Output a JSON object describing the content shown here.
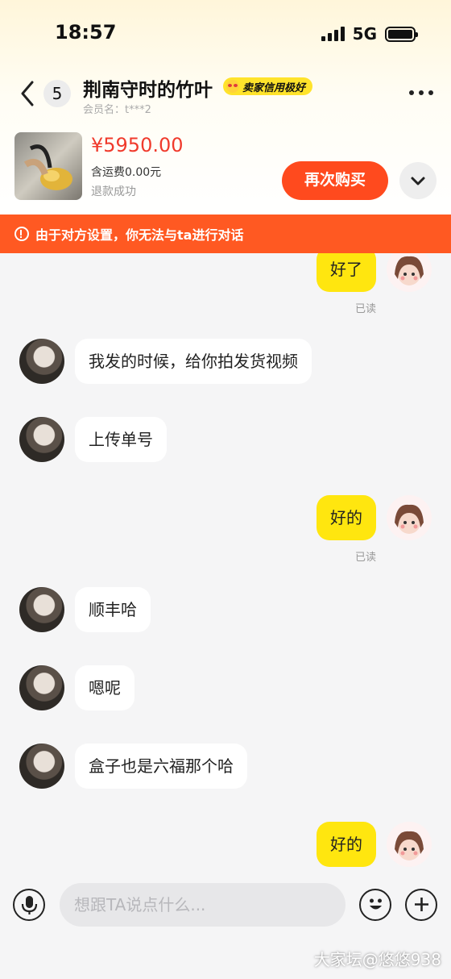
{
  "status_bar": {
    "time": "18:57",
    "network": "5G"
  },
  "header": {
    "unread_count": "5",
    "title": "荆南守时的竹叶",
    "credit_badge": "卖家信用极好",
    "member_label": "会员名：t***2"
  },
  "product": {
    "price": "¥5950.00",
    "shipping": "含运费0.00元",
    "status": "退款成功",
    "buy_again_label": "再次购买"
  },
  "warning": {
    "text": "由于对方设置，你无法与ta进行对话"
  },
  "messages": [
    {
      "side": "out",
      "text": "好了",
      "read": "已读"
    },
    {
      "side": "in",
      "text": "我发的时候，给你拍发货视频"
    },
    {
      "side": "in",
      "text": "上传单号"
    },
    {
      "side": "out",
      "text": "好的",
      "read": "已读"
    },
    {
      "side": "in",
      "text": "顺丰哈"
    },
    {
      "side": "in",
      "text": "嗯呢"
    },
    {
      "side": "in",
      "text": "盒子也是六福那个哈"
    },
    {
      "side": "out",
      "text": "好的"
    }
  ],
  "input": {
    "placeholder": "想跟TA说点什么..."
  },
  "watermark": "大家坛@悠悠938",
  "colors": {
    "accent": "#ff4a1e",
    "price": "#f03a2c",
    "bubble_out": "#ffe60f",
    "warning": "#ff5922"
  }
}
